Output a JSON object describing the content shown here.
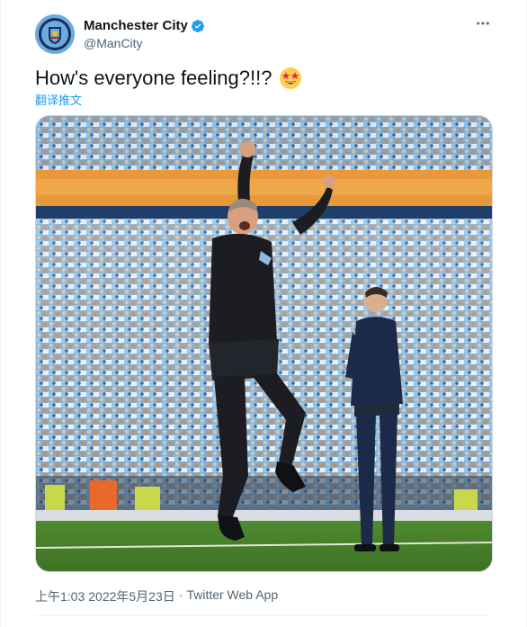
{
  "account": {
    "display_name": "Manchester City",
    "handle": "@ManCity",
    "verified": true,
    "brand_color": "#6cabdd",
    "verified_color": "#1d9bf0"
  },
  "tweet": {
    "text": "How's everyone feeling?!!?",
    "emoji": "🤩",
    "translate_label": "翻译推文",
    "time": "上午1:03",
    "date": "2022年5月23日",
    "separator": "·",
    "source": "Twitter Web App"
  },
  "icons": {
    "more": "more-horizontal-icon",
    "verified": "verified-badge-icon"
  }
}
